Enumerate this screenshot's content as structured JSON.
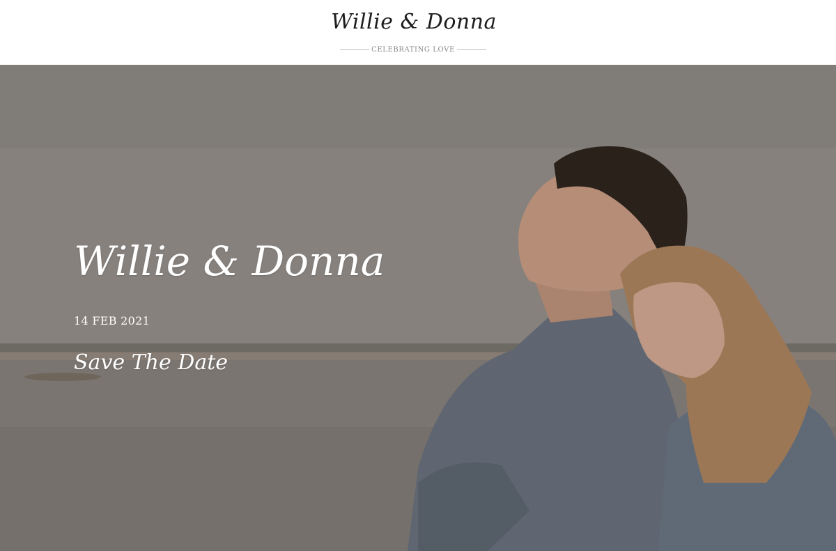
{
  "header": {
    "logo_text": "Willie & Donna",
    "tagline": "CELEBRATING LOVE"
  },
  "hero": {
    "title": "Willie & Donna",
    "date": "14 FEB 2021",
    "subtitle": "Save The Date"
  }
}
